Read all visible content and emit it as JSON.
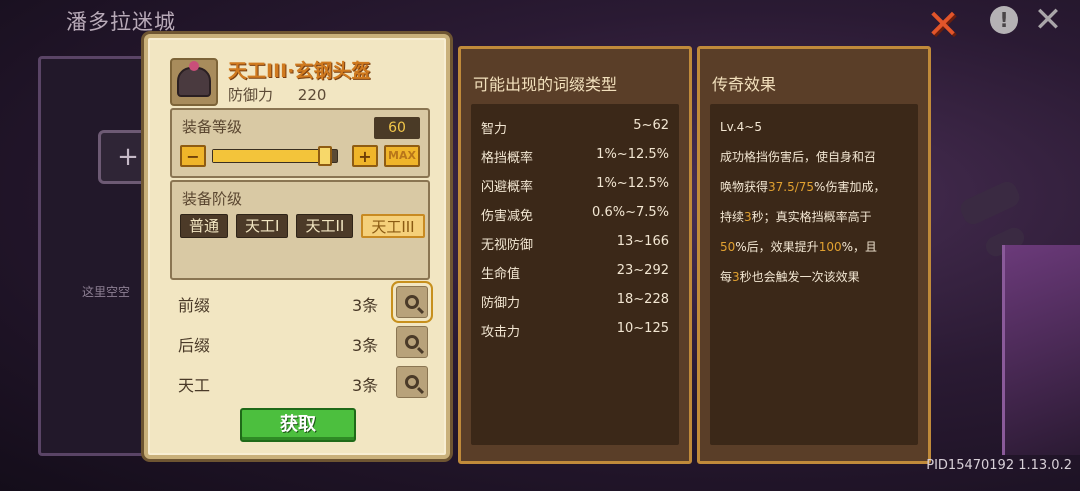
{
  "background": {
    "title": "潘多拉迷城",
    "plus_symbol": "+",
    "empty_text": "这里空空"
  },
  "top_icons": {
    "close_orange": "close-icon",
    "info": "info-icon",
    "close_grey": "close-icon"
  },
  "equipment": {
    "name": "天工III·玄钢头盔",
    "stat_label": "防御力",
    "stat_value": "220",
    "level": {
      "label": "装备等级",
      "value": "60",
      "minus": "−",
      "plus": "+",
      "max": "MAX",
      "fill_fraction": 0.9
    },
    "tier": {
      "label": "装备阶级",
      "options": [
        "普通",
        "天工I",
        "天工II",
        "天工III"
      ],
      "selected_index": 3
    },
    "affixes": [
      {
        "name": "前缀",
        "count": "3条",
        "selected": true
      },
      {
        "name": "后缀",
        "count": "3条",
        "selected": false
      },
      {
        "name": "天工",
        "count": "3条",
        "selected": false
      }
    ],
    "obtain_label": "获取"
  },
  "affix_types": {
    "title": "可能出现的词缀类型",
    "rows": [
      {
        "name": "智力",
        "range": "5~62"
      },
      {
        "name": "格挡概率",
        "range": "1%~12.5%"
      },
      {
        "name": "闪避概率",
        "range": "1%~12.5%"
      },
      {
        "name": "伤害减免",
        "range": "0.6%~7.5%"
      },
      {
        "name": "无视防御",
        "range": "13~166"
      },
      {
        "name": "生命值",
        "range": "23~292"
      },
      {
        "name": "防御力",
        "range": "18~228"
      },
      {
        "name": "攻击力",
        "range": "10~125"
      }
    ]
  },
  "legendary": {
    "title": "传奇效果",
    "level_range": "Lv.4~5",
    "line1": "成功格挡伤害后，使自身和召",
    "line2_a": "唤物获得",
    "line2_hl": "37.5/75",
    "line2_b": "%伤害加成，",
    "line3_a": "持续",
    "line3_hl": "3",
    "line3_b": "秒；真实格挡概率高于",
    "line4_hl1": "50",
    "line4_a": "%后，效果提升",
    "line4_hl2": "100",
    "line4_b": "%，且",
    "line5_a": "每",
    "line5_hl": "3",
    "line5_b": "秒也会触发一次该效果",
    "highlight_color": "#e0a030"
  },
  "version": "PID15470192 1.13.0.2"
}
